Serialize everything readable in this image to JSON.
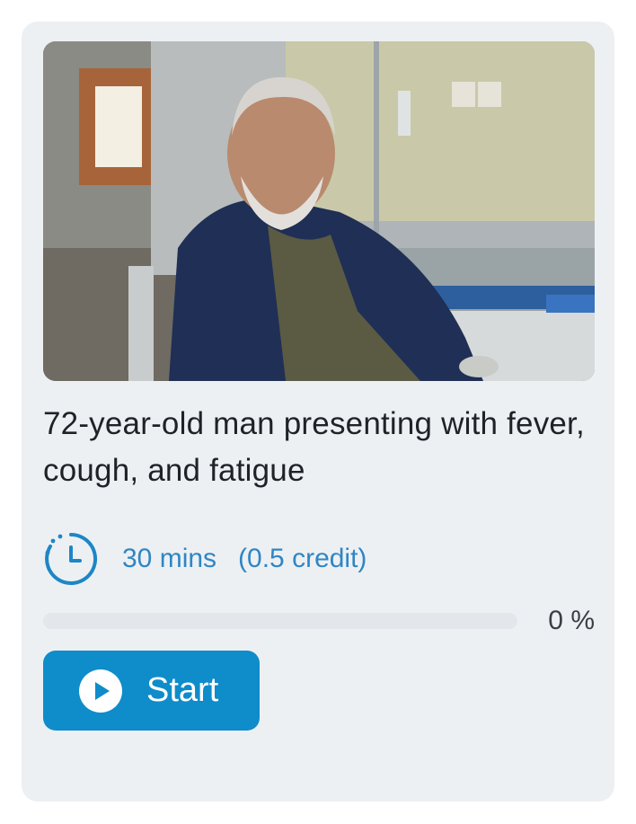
{
  "card": {
    "image": {
      "description_icon": "patient-photo"
    },
    "title": "72-year-old man presenting with fever, cough, and fatigue",
    "duration": "30 mins",
    "credit": "(0.5 credit)",
    "progress": {
      "percent_label": "0 %",
      "value": 0
    },
    "start_button": {
      "label": "Start",
      "icon": "play-icon"
    },
    "colors": {
      "accent": "#0f8cca",
      "meta_text": "#2f86c4",
      "card_bg": "#edf0f3"
    }
  }
}
